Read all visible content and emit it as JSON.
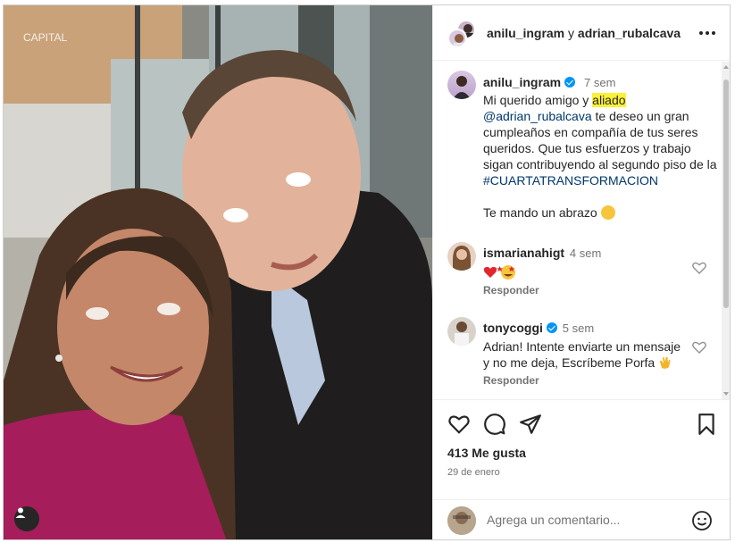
{
  "header": {
    "user1": "anilu_ingram",
    "connector": "y",
    "user2": "adrian_rubalcava"
  },
  "photo": {
    "sign_text": "CAPITAL"
  },
  "caption": {
    "username": "anilu_ingram",
    "time": "7 sem",
    "text_before": "Mi querido amigo y ",
    "highlight": "aliado",
    "mention": "@adrian_rubalcava",
    "text_middle": " te deseo un gran cumpleaños en compañía de tus seres queridos. Que tus esfuerzos y trabajo sigan contribuyendo al segundo piso de la ",
    "hashtag": "#CUARTATRANSFORMACION",
    "closing": "Te mando un abrazo"
  },
  "comments": [
    {
      "username": "ismarianahigt",
      "time": "4 sem",
      "reply": "Responder"
    },
    {
      "username": "tonycoggi",
      "time": "5 sem",
      "text": "Adrian! Intente enviarte un mensaje y no me deja, Escríbeme Porfa",
      "reply": "Responder"
    }
  ],
  "likes": "413 Me gusta",
  "date": "29 de enero",
  "comment_input": {
    "placeholder": "Agrega un comentario..."
  },
  "icons": {
    "like": "heart-icon",
    "comment": "comment-bubble-icon",
    "share": "paper-plane-icon",
    "save": "bookmark-icon",
    "more": "more-options-icon",
    "emoji": "smiley-icon",
    "tag": "user-tag-icon"
  },
  "colors": {
    "verified": "#0095f6",
    "highlight": "#fbf03a",
    "link": "#00376b",
    "heart_red": "#e3262e"
  }
}
